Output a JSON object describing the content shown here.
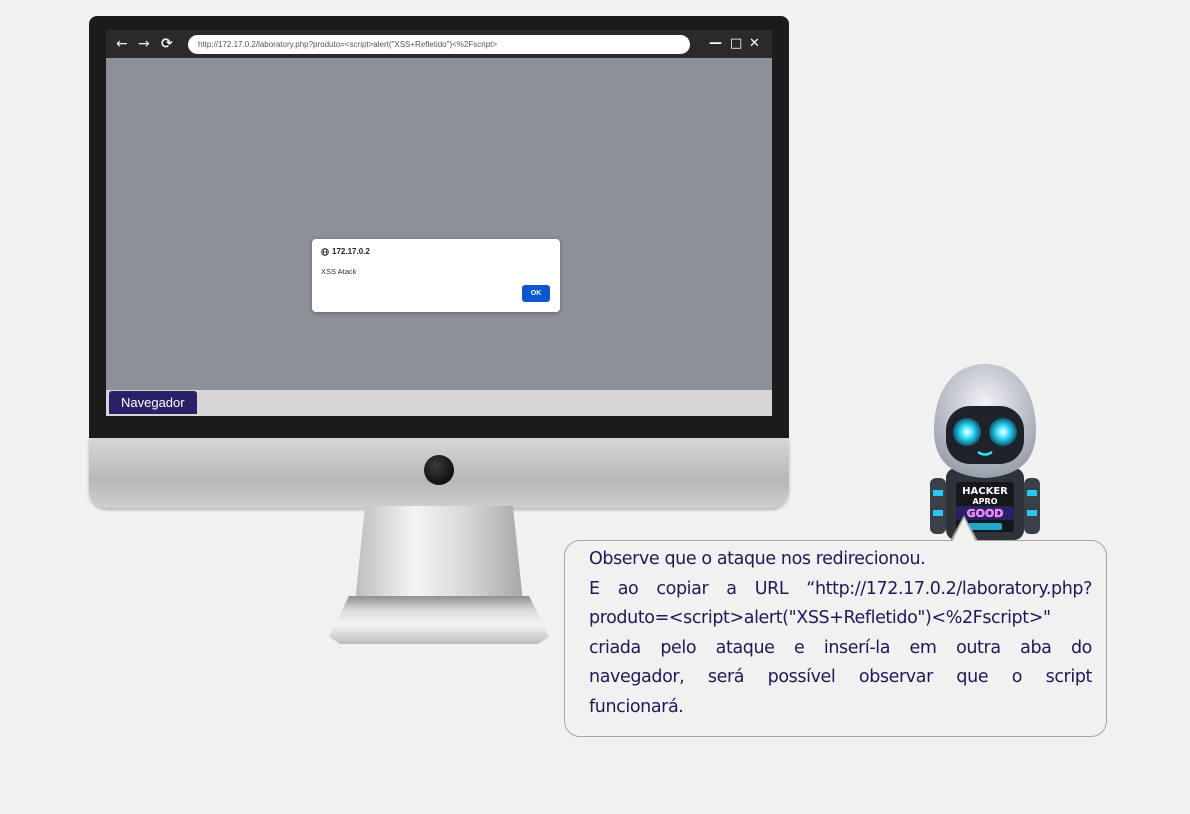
{
  "browser": {
    "url": "http://172.17.0.2/laboratory.php?produto=<script>alert(\"XSS+Refletido\")<%2Fscript>",
    "nav": {
      "back": "←",
      "forward": "→",
      "reload": "⟳"
    },
    "window_controls": {
      "minimize": "—",
      "maximize": "□",
      "close": "✕"
    }
  },
  "alert": {
    "origin": "172.17.0.2",
    "message": "XSS Atack",
    "ok_label": "OK"
  },
  "taskbar": {
    "item_label": "Navegador"
  },
  "robot": {
    "badge_line1": "HACKER",
    "badge_line2": "APRO",
    "badge_line3": "GOOD"
  },
  "bubble": {
    "lines": [
      "Observe que o ataque nos redirecionou.",
      "E ao copiar a URL “http://172.17.0.2/laboratory.php?",
      "produto=<script>alert(\"XSS+Refletido\")<%2Fscript>\"",
      "criada pelo ataque e inserí-la em outra aba do",
      "navegador, será possível observar que o script",
      "funcionará."
    ]
  },
  "colors": {
    "accent": "#2a2068",
    "text": "#1e1a57",
    "ok_button": "#0b57d0",
    "screen_bg": "#8c9098"
  }
}
